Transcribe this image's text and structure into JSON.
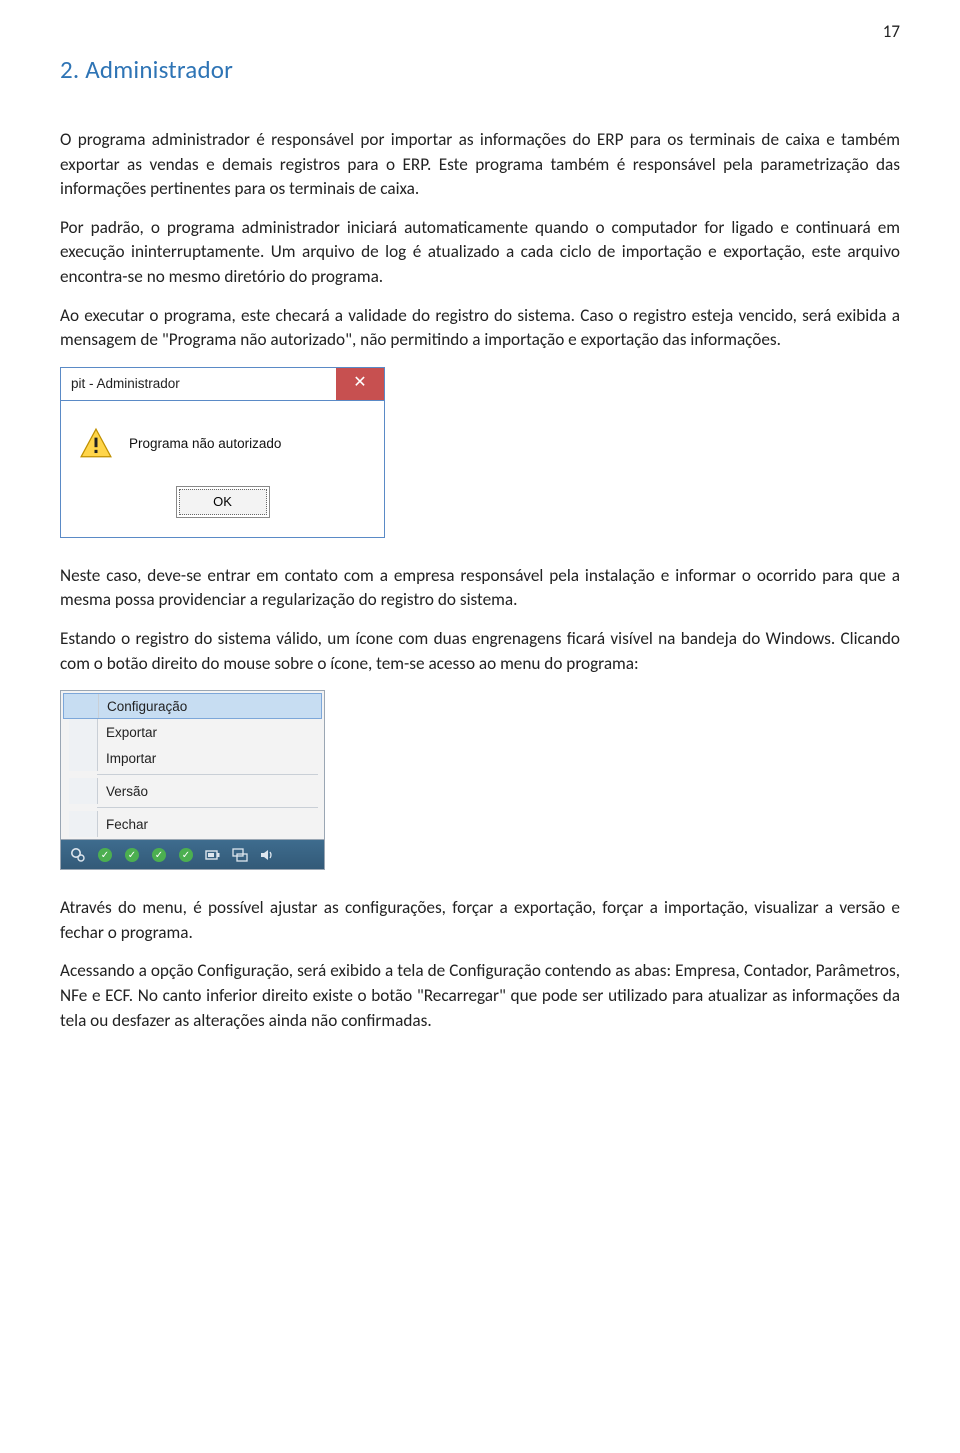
{
  "page_number": "17",
  "section_heading": "2. Administrador",
  "paragraphs": {
    "p1": "O programa administrador é responsável por importar as informações do ERP para os terminais de caixa e também exportar as vendas e demais registros para o ERP. Este programa também é responsável pela parametrização das informações pertinentes para os terminais de caixa.",
    "p2": "Por padrão, o programa administrador iniciará automaticamente quando o computador for ligado e continuará em execução ininterruptamente. Um arquivo de log é atualizado a cada ciclo de importação e exportação, este arquivo encontra-se no mesmo diretório do programa.",
    "p3": "Ao executar o programa, este checará a validade do registro do sistema. Caso o registro esteja vencido, será exibida a mensagem de \"Programa não autorizado\", não permitindo a importação e exportação das informações.",
    "p4": "Neste caso, deve-se entrar em contato com a empresa responsável pela instalação e informar o ocorrido para que a mesma possa providenciar a regularização do registro do sistema.",
    "p5": "Estando o registro do sistema válido, um ícone com duas engrenagens ficará visível na bandeja do Windows. Clicando com o botão direito do mouse sobre o ícone, tem-se acesso ao menu do programa:",
    "p6": "Através do menu, é possível ajustar as configurações, forçar a exportação, forçar a importação, visualizar a versão e fechar o programa.",
    "p7": "Acessando a opção Configuração, será exibido a tela de Configuração contendo as abas: Empresa, Contador, Parâmetros, NFe e ECF. No canto inferior direito existe o botão \"Recarregar\" que pode ser utilizado para atualizar as informações da tela ou desfazer as alterações ainda não confirmadas."
  },
  "dialog": {
    "title": "pit - Administrador",
    "close_glyph": "✕",
    "message": "Programa não autorizado",
    "ok_label": "OK"
  },
  "menu": {
    "items": {
      "configuracao": "Configuração",
      "exportar": "Exportar",
      "importar": "Importar",
      "versao": "Versão",
      "fechar": "Fechar"
    }
  }
}
